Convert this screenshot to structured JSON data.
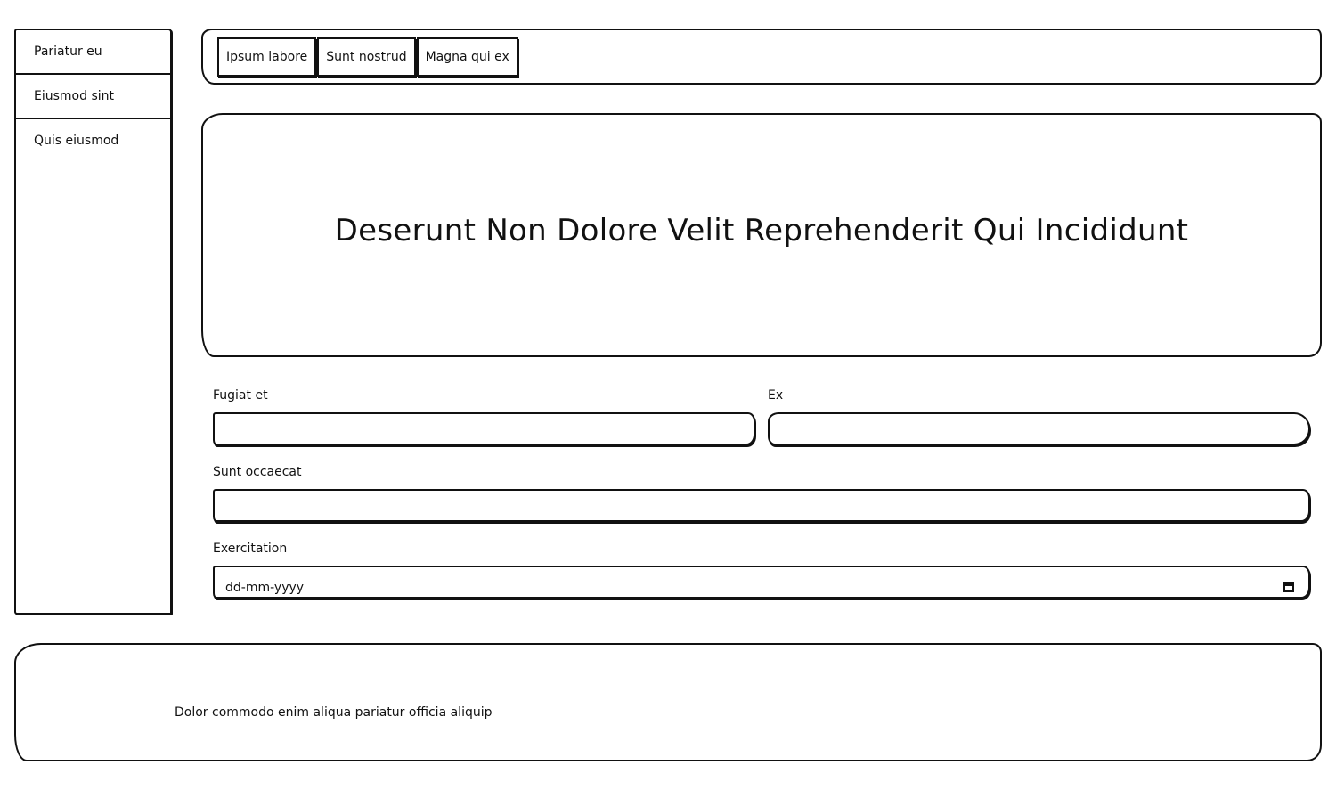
{
  "sidebar": {
    "items": [
      {
        "label": "Pariatur eu"
      },
      {
        "label": "Eiusmod sint"
      },
      {
        "label": "Quis eiusmod"
      }
    ]
  },
  "tabs": [
    {
      "label": "Ipsum labore"
    },
    {
      "label": "Sunt nostrud"
    },
    {
      "label": "Magna qui ex"
    }
  ],
  "hero": {
    "title": "Deserunt Non Dolore Velit Reprehenderit Qui Incididunt"
  },
  "form": {
    "field1": {
      "label": "Fugiat et",
      "value": ""
    },
    "field2": {
      "label": "Ex",
      "value": ""
    },
    "field3": {
      "label": "Sunt occaecat",
      "value": ""
    },
    "field4": {
      "label": "Exercitation",
      "placeholder": "dd-mm-yyyy"
    }
  },
  "footer": {
    "text": "Dolor commodo enim aliqua pariatur officia aliquip"
  }
}
